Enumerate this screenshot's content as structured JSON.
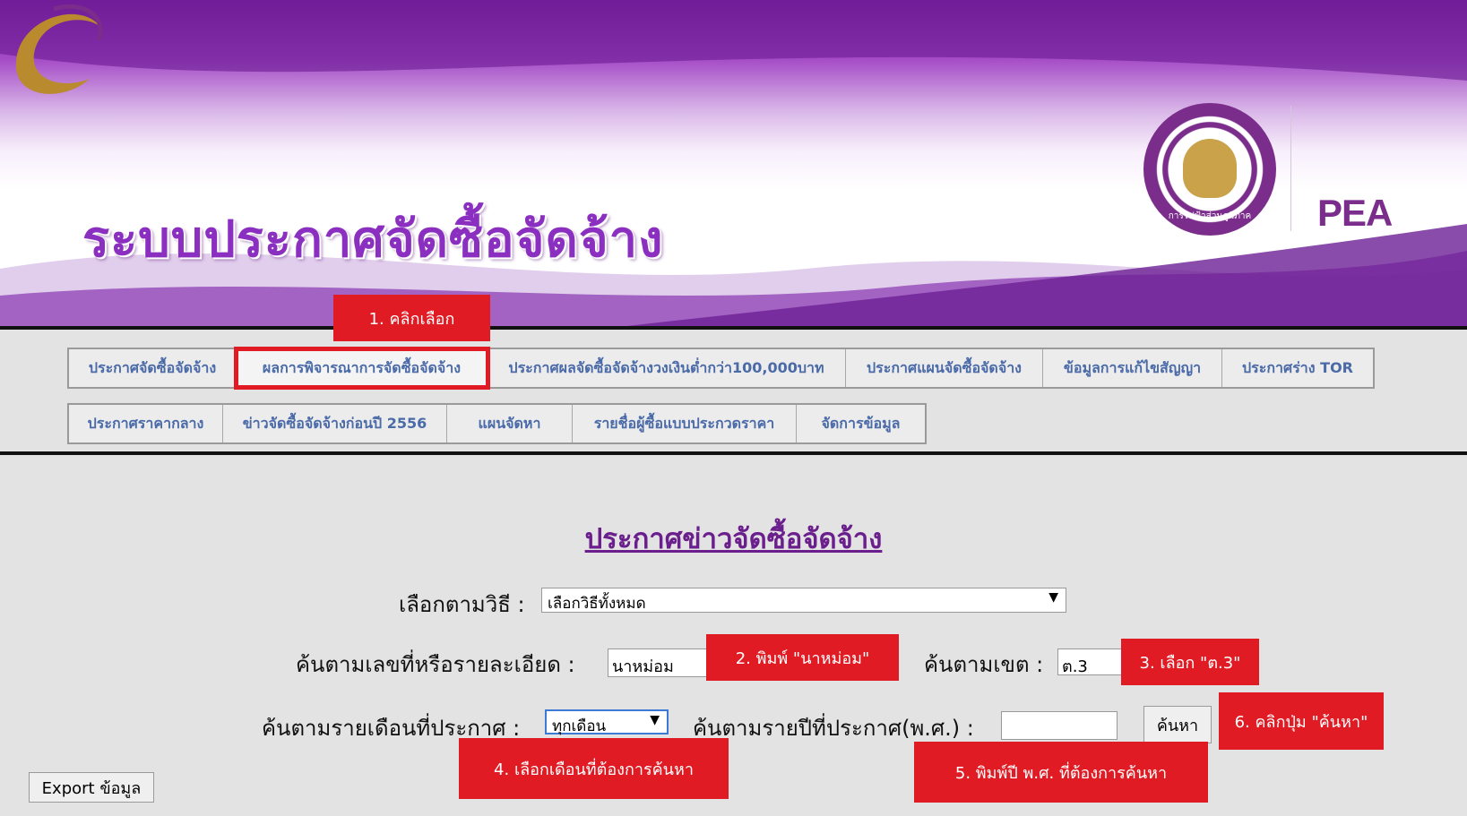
{
  "banner": {
    "title": "ระบบประกาศจัดซื้อจัดจ้าง",
    "seal_text": "การไฟฟ้าส่วนภูมิภาค",
    "logo_text": "PEA"
  },
  "nav": {
    "row1": [
      "ประกาศจัดซื้อจัดจ้าง",
      "ผลการพิจารณาการจัดซื้อจัดจ้าง",
      "ประกาศผลจัดซื้อจัดจ้างวงเงินต่ำกว่า100,000บาท",
      "ประกาศแผนจัดซื้อจัดจ้าง",
      "ข้อมูลการแก้ไขสัญญา",
      "ประกาศร่าง TOR"
    ],
    "row2": [
      "ประกาศราคากลาง",
      "ข่าวจัดซื้อจัดจ้างก่อนปี 2556",
      "แผนจัดหา",
      "รายชื่อผู้ซื้อแบบประกวดราคา",
      "จัดการข้อมูล"
    ]
  },
  "form": {
    "heading": "ประกาศข่าวจัดซื้อจัดจ้าง",
    "method_label": "เลือกตามวิธี :",
    "method_value": "เลือกวิธีทั้งหมด",
    "keyword_label": "ค้นตามเลขที่หรือรายละเอียด :",
    "keyword_value": "นาหม่อม",
    "district_label": "ค้นตามเขต :",
    "district_value": "ต.3",
    "month_label": "ค้นตามรายเดือนที่ประกาศ :",
    "month_value": "ทุกเดือน",
    "year_label": "ค้นตามรายปีที่ประกาศ(พ.ศ.) :",
    "year_value": "",
    "search_button": "ค้นหา",
    "export_button": "Export ข้อมูล"
  },
  "callouts": {
    "step1": "1. คลิกเลือก",
    "step2": "2. พิมพ์ \"นาหม่อม\"",
    "step3": "3. เลือก \"ต.3\"",
    "step4": "4. เลือกเดือนที่ต้องการค้นหา",
    "step5": "5. พิมพ์ปี พ.ศ. ที่ต้องการค้นหา",
    "step6": "6. คลิกปุ่ม \"ค้นหา\""
  },
  "colors": {
    "accent_purple": "#7b2d8c",
    "menu_text": "#4a6aa8",
    "callout_red": "#e01b24"
  }
}
